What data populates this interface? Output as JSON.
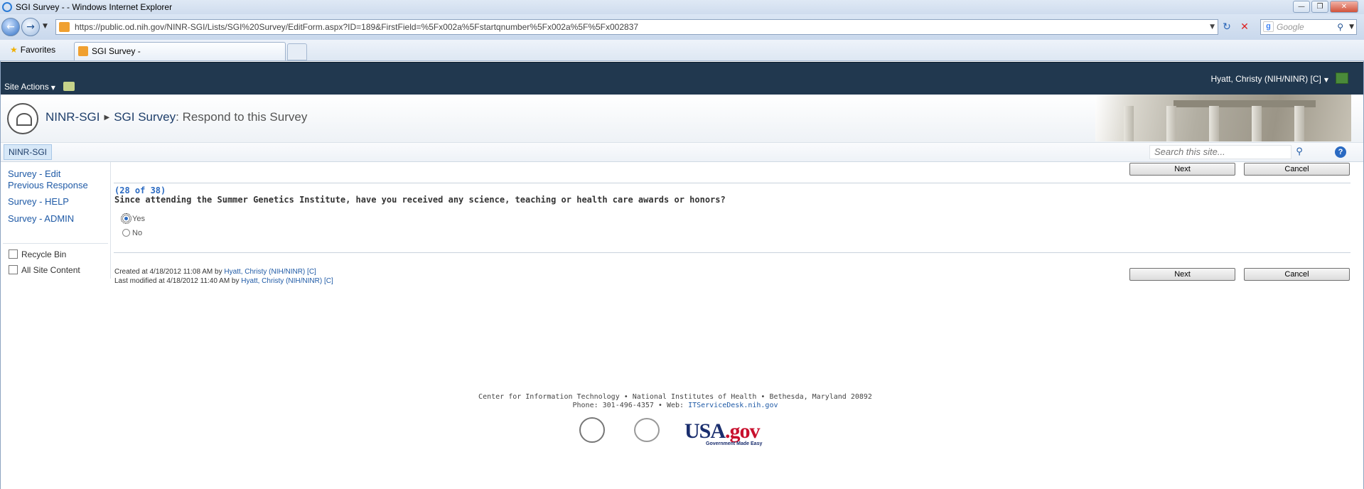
{
  "window": {
    "title": "SGI Survey - - Windows Internet Explorer"
  },
  "browser": {
    "url": "https://public.od.nih.gov/NINR-SGI/Lists/SGI%20Survey/EditForm.aspx?ID=189&FirstField=%5Fx002a%5Fstartqnumber%5Fx002a%5F%5Fx002837",
    "search_placeholder": "Google",
    "favorites_label": "Favorites",
    "tab_label": "SGI Survey -"
  },
  "ribbon": {
    "site_actions": "Site Actions",
    "user": "Hyatt, Christy (NIH/NINR) [C]"
  },
  "header": {
    "site": "NINR-SGI",
    "list": "SGI Survey",
    "page": ": Respond to this Survey"
  },
  "topnav": {
    "tab": "NINR-SGI",
    "search_placeholder": "Search this site..."
  },
  "leftnav": {
    "links": [
      "Survey - Edit Previous Response",
      "Survey - HELP",
      "Survey - ADMIN"
    ],
    "link1_line1": "Survey - Edit",
    "link1_line2": "Previous Response",
    "recycle_bin": "Recycle Bin",
    "all_site_content": "All Site Content"
  },
  "form": {
    "next_label": "Next",
    "cancel_label": "Cancel",
    "progress": "(28 of 38)",
    "question": "Since attending the Summer Genetics Institute, have you received any science, teaching or health care awards or honors?",
    "options": [
      {
        "label": "Yes",
        "selected": true
      },
      {
        "label": "No",
        "selected": false
      }
    ]
  },
  "meta": {
    "created_prefix": "Created at 4/18/2012 11:08 AM by ",
    "created_by": "Hyatt, Christy (NIH/NINR) [C]",
    "modified_prefix": "Last modified at 4/18/2012 11:40 AM by ",
    "modified_by": "Hyatt, Christy (NIH/NINR) [C]"
  },
  "footer": {
    "line1": "Center for Information Technology • National Institutes of Health • Bethesda, Maryland 20892",
    "line2_prefix": "Phone: 301-496-4357 • Web: ",
    "line2_link": "ITServiceDesk.nih.gov",
    "usa_logo": "USA",
    "usa_logo_gov": ".gov",
    "usa_tagline": "Government Made Easy"
  }
}
